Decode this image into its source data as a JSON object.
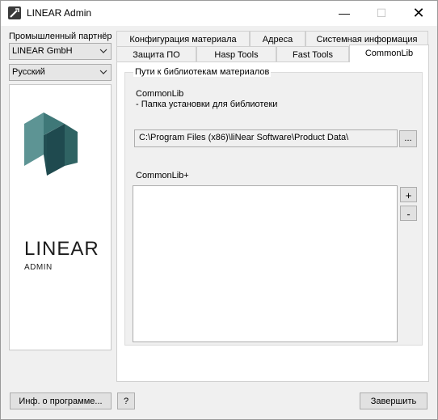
{
  "window": {
    "title": "LINEAR Admin",
    "minimize_glyph": "—",
    "maximize_glyph": "☐",
    "close_glyph": "✕"
  },
  "sidebar": {
    "partner_label": "Промышленный партнёр",
    "partner_value": "LINEAR GmbH",
    "language_value": "Русский",
    "logo_text": "LINEAR",
    "logo_subtext": "ADMIN"
  },
  "tabs": {
    "row1": [
      "Конфигурация материала",
      "Адреса",
      "Системная информация"
    ],
    "row2": [
      "Защита ПО",
      "Hasp Tools",
      "Fast Tools",
      "CommonLib"
    ],
    "active": "CommonLib"
  },
  "commonlib": {
    "group_title": "Пути к библиотекам материалов",
    "section_title": "CommonLib",
    "section_desc": "- Папка установки для библиотеки",
    "path_value": "C:\\Program Files (x86)\\liNear Software\\Product Data\\",
    "browse_label": "...",
    "plus_title": "CommonLib+",
    "add_label": "+",
    "remove_label": "-",
    "plus_items": []
  },
  "footer": {
    "about_label": "Инф. о программе...",
    "help_label": "?",
    "finish_label": "Завершить"
  },
  "colors": {
    "logo_teal_dark": "#1f4a4f",
    "logo_teal_light": "#5d9494"
  }
}
